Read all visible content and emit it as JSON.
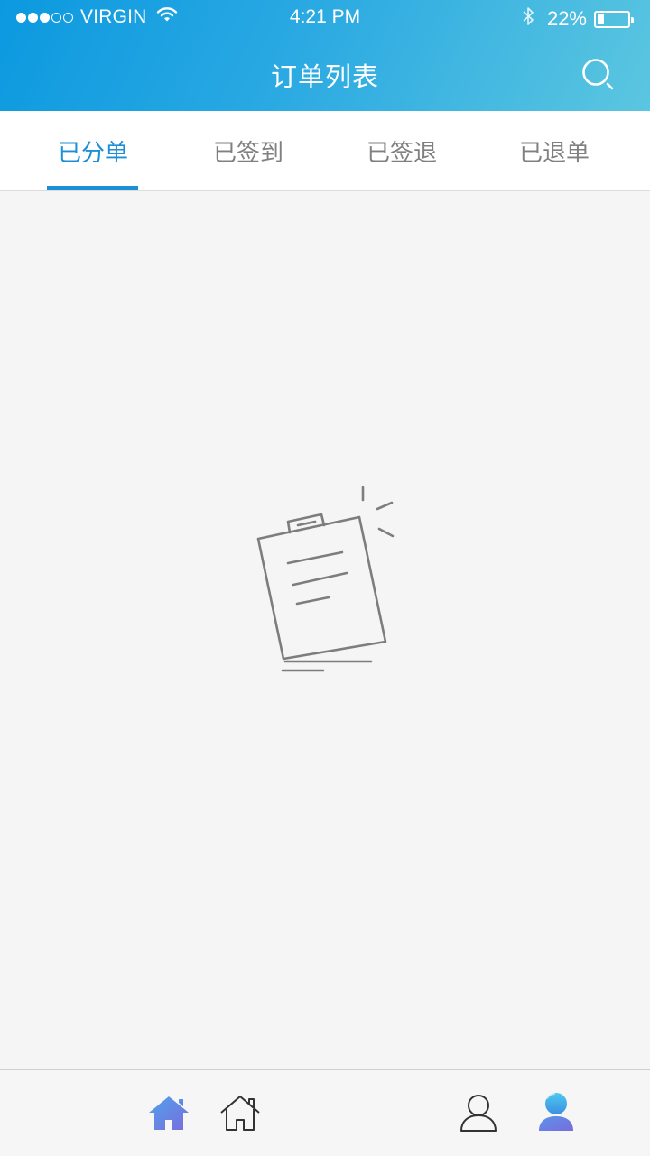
{
  "status_bar": {
    "carrier": "VIRGIN",
    "signal_dots_filled": 3,
    "signal_dots_total": 5,
    "time": "4:21 PM",
    "battery_percent": "22%",
    "battery_level": 0.22,
    "icons": [
      "wifi-icon",
      "bluetooth-icon",
      "battery-icon"
    ]
  },
  "header": {
    "title": "订单列表",
    "search_icon": "search-icon"
  },
  "tabs": [
    {
      "label": "已分单",
      "active": true
    },
    {
      "label": "已签到",
      "active": false
    },
    {
      "label": "已签退",
      "active": false
    },
    {
      "label": "已退单",
      "active": false
    }
  ],
  "empty_state": {
    "icon": "empty-clipboard-icon"
  },
  "bottom_nav": {
    "items": [
      {
        "icon": "home-filled-icon",
        "active": true
      },
      {
        "icon": "home-outline-icon",
        "active": false
      },
      {
        "icon": "user-outline-icon",
        "active": false
      },
      {
        "icon": "user-filled-icon",
        "active": true
      }
    ]
  },
  "colors": {
    "accent": "#1c8fd6",
    "header_gradient_start": "#0c99e0",
    "header_gradient_end": "#5bc6e0",
    "inactive_text": "#808080",
    "background": "#f5f5f5",
    "nav_gradient_start": "#4fa3ea",
    "nav_gradient_end": "#7a6cde"
  }
}
